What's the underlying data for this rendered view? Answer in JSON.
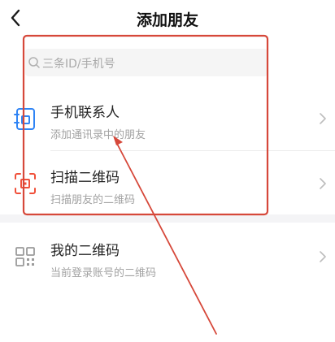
{
  "header": {
    "title": "添加朋友",
    "back_icon": "chevron-left-icon"
  },
  "search": {
    "placeholder": "三条ID/手机号",
    "icon": "search-icon"
  },
  "items": [
    {
      "label": "手机联系人",
      "sub": "添加通讯录中的朋友",
      "icon": "contacts-book-icon",
      "icon_color": "#2f84f5"
    },
    {
      "label": "扫描二维码",
      "sub": "扫描朋友的二维码",
      "icon": "scan-qr-icon",
      "icon_color": "#f0503a"
    },
    {
      "label": "我的二维码",
      "sub": "当前登录账号的二维码",
      "icon": "my-qr-icon",
      "icon_color": "#9b9b9b"
    }
  ],
  "annotation": {
    "color": "#d6483a"
  }
}
